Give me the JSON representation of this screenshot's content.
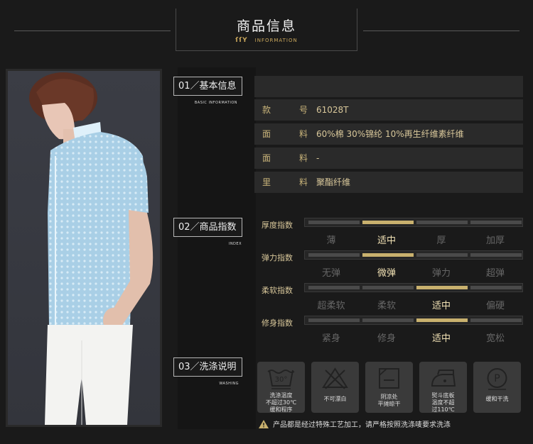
{
  "header": {
    "title": "商品信息",
    "logo": "ſſY",
    "subtitle": "INFORMATION"
  },
  "sections": {
    "basic": {
      "label": "01／基本信息",
      "en": "BASIC INFORMATION"
    },
    "index": {
      "label": "02／商品指数",
      "en": "INDEX"
    },
    "washing": {
      "label": "03／洗涤说明",
      "en": "WASHING"
    }
  },
  "info_rows": [
    {
      "k1": "款",
      "k2": "号",
      "value": "61028T"
    },
    {
      "k1": "面",
      "k2": "料",
      "value": "60%棉  30%锦纶  10%再生纤维素纤维"
    },
    {
      "k1": "面",
      "k2": "料",
      "value": "-"
    },
    {
      "k1": "里",
      "k2": "料",
      "value": "聚酯纤维"
    }
  ],
  "indices": [
    {
      "label": "厚度指数",
      "options": [
        "薄",
        "适中",
        "厚",
        "加厚"
      ],
      "selected": 1
    },
    {
      "label": "弹力指数",
      "options": [
        "无弹",
        "微弹",
        "弹力",
        "超弹"
      ],
      "selected": 1
    },
    {
      "label": "柔软指数",
      "options": [
        "超柔软",
        "柔软",
        "适中",
        "偏硬"
      ],
      "selected": 2
    },
    {
      "label": "修身指数",
      "options": [
        "紧身",
        "修身",
        "适中",
        "宽松"
      ],
      "selected": 2
    }
  ],
  "washing": [
    {
      "icon": "wash-30-icon",
      "lines": [
        "洗涤温度",
        "不超过30℃",
        "缓和程序"
      ]
    },
    {
      "icon": "no-bleach-icon",
      "lines": [
        "不可漂白"
      ]
    },
    {
      "icon": "dry-flat-shade-icon",
      "lines": [
        "阴凉处",
        "平摊晾干"
      ]
    },
    {
      "icon": "iron-110-icon",
      "lines": [
        "熨斗底板",
        "温度不超",
        "过110℃"
      ]
    },
    {
      "icon": "dry-clean-p-icon",
      "lines": [
        "缓和干洗"
      ]
    }
  ],
  "warning": "产品都是经过特殊工艺加工，请严格按照洗涤唛要求洗涤",
  "colors": {
    "accent": "#c9b16e",
    "background": "#1a1a1a",
    "row": "#2a2a2a"
  }
}
